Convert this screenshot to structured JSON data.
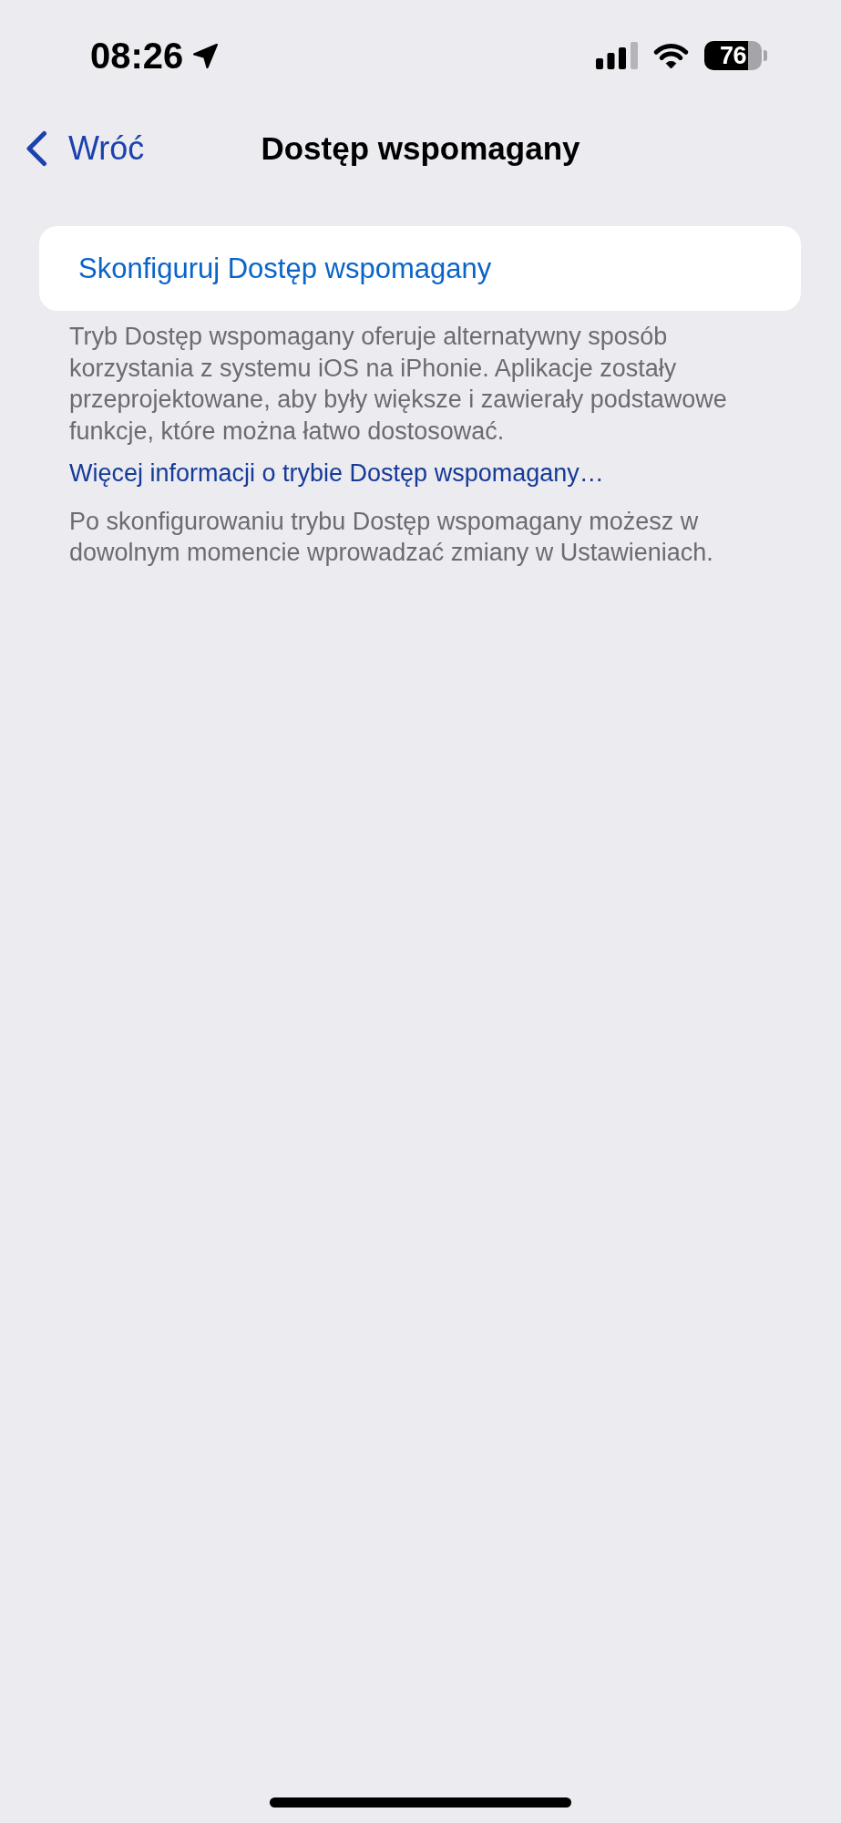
{
  "status_bar": {
    "time": "08:26",
    "battery": "76"
  },
  "nav_bar": {
    "back": "Wróć",
    "title": "Dostęp wspomagany"
  },
  "group": {
    "button": "Skonfiguruj Dostęp wspomagany"
  },
  "footer": {
    "description": "Tryb Dostęp wspomagany oferuje alternatywny sposób korzystania z systemu iOS na iPhonie. Aplikacje zostały przeprojektowane, aby były większe i zawierały podstawowe funkcje, które można łatwo dostosować.",
    "link": "Więcej informacji o trybie Dostęp wspomagany…",
    "note": "Po skonfigurowaniu trybu Dostęp wspomagany możesz w dowolnym momencie wprowadzać zmiany w Ustawieniach."
  }
}
